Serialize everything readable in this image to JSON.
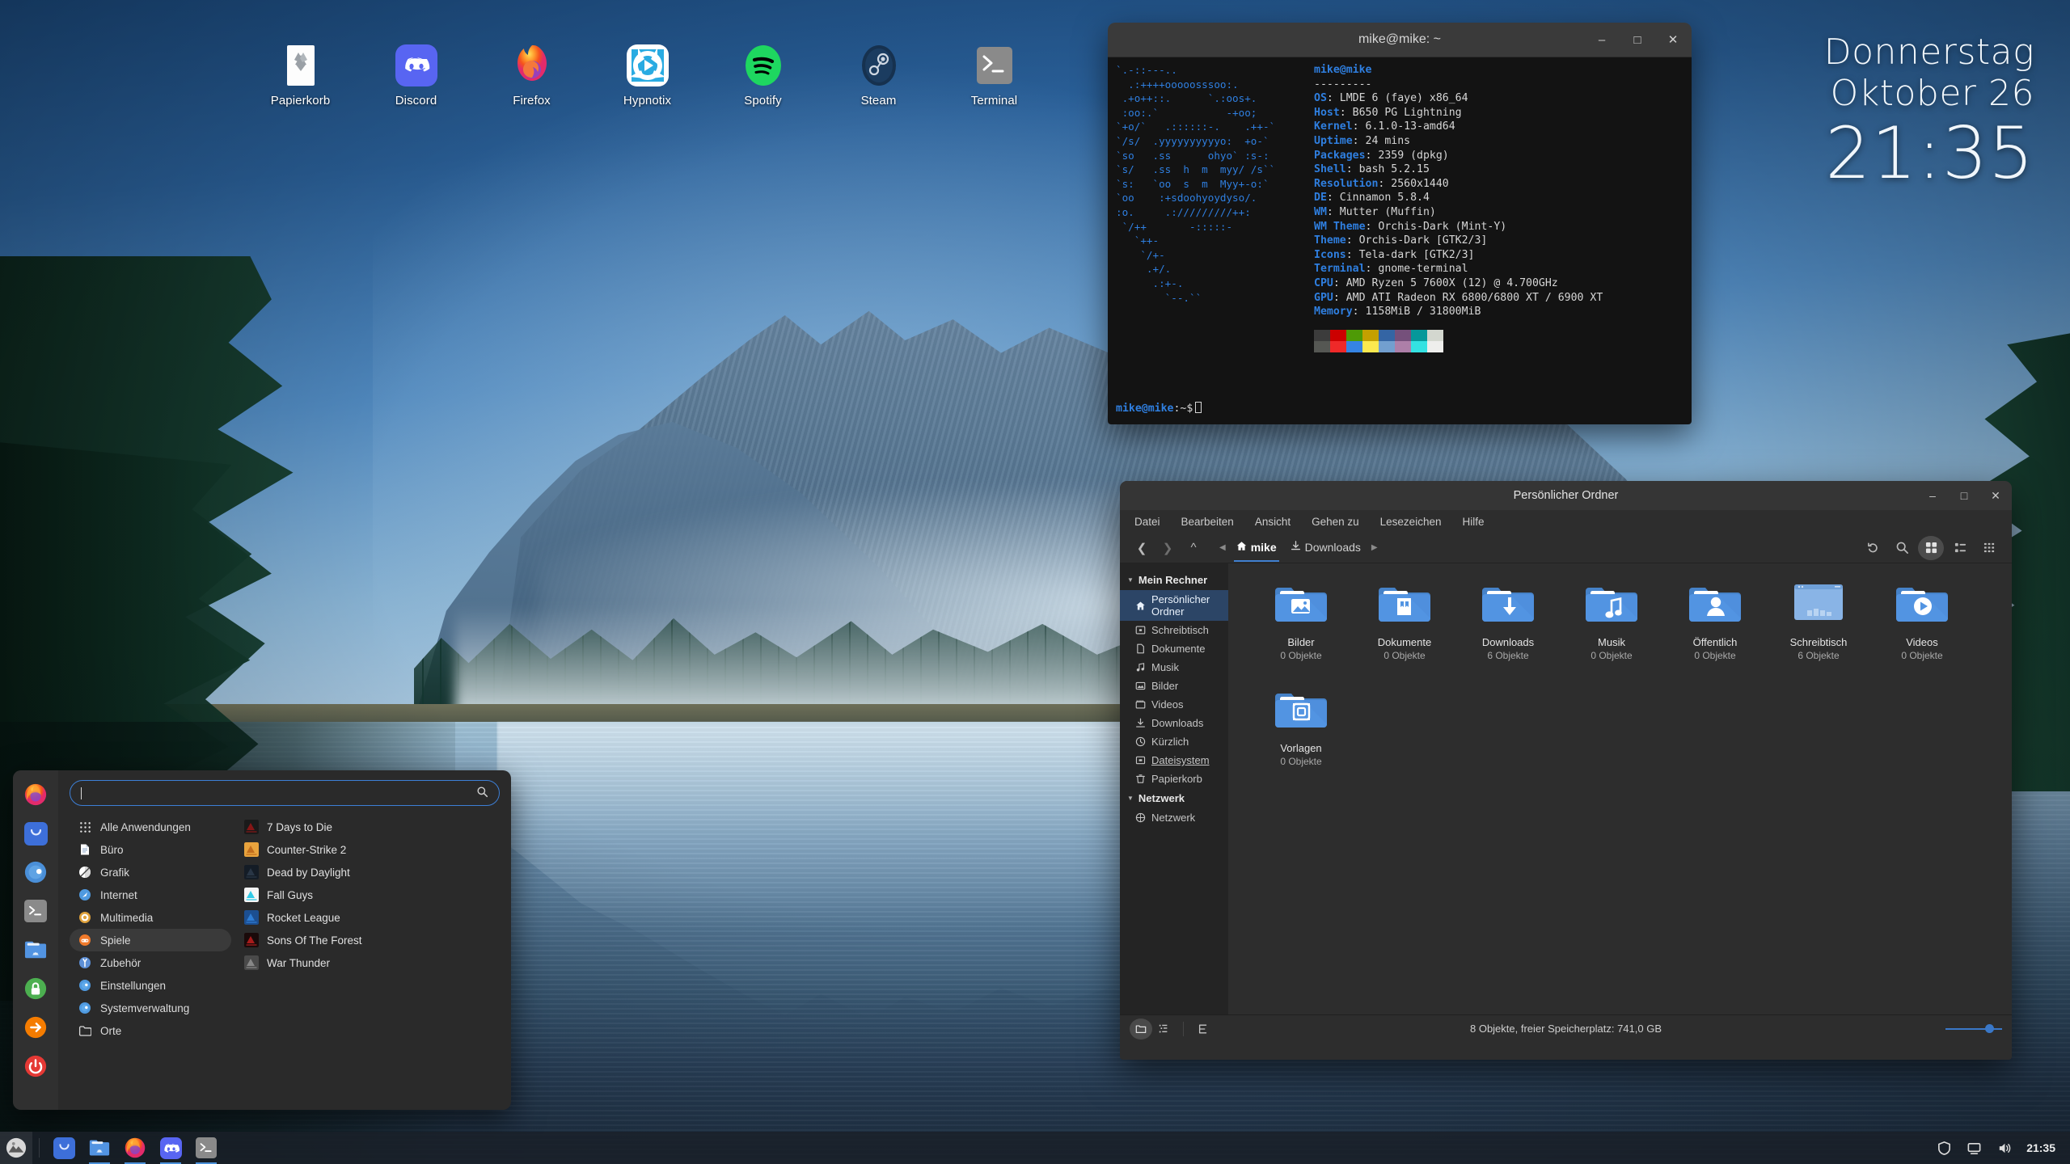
{
  "desktop": {
    "icons": [
      {
        "label": "Papierkorb",
        "icon": "trash-icon"
      },
      {
        "label": "Discord",
        "icon": "discord-icon"
      },
      {
        "label": "Firefox",
        "icon": "firefox-icon"
      },
      {
        "label": "Hypnotix",
        "icon": "hypnotix-icon"
      },
      {
        "label": "Spotify",
        "icon": "spotify-icon"
      },
      {
        "label": "Steam",
        "icon": "steam-icon"
      },
      {
        "label": "Terminal",
        "icon": "terminal-icon"
      }
    ]
  },
  "clock_widget": {
    "weekday": "Donnerstag",
    "date": "Oktober 26",
    "time": "21:35"
  },
  "terminal": {
    "title": "mike@mike: ~",
    "window_buttons": {
      "minimize": "–",
      "maximize": "□",
      "close": "✕"
    },
    "ascii_art": "`.-::---..\n  .:++++ooooosssoo:.\n .+o++::.      `.:oos+.\n :oo:.`           -+oo;\n`+o/`   .::::::-.    .++-`\n`/s/  .yyyyyyyyyyo:  +o-`\n`so   .ss      ohyo` :s-:\n`s/   .ss  h  m  myy/ /s``\n`s:   `oo  s  m  Myy+-o:`\n`oo    :+sdoohyoydyso/.\n:o.     .://///////++:\n `/++       -:::::-\n   `++-\n    `/+-\n     .+/.\n      .:+-.\n        `--.``",
    "user_line": "mike@mike",
    "divider": "---------",
    "info": [
      {
        "key": "OS",
        "value": "LMDE 6 (faye) x86_64"
      },
      {
        "key": "Host",
        "value": "B650 PG Lightning"
      },
      {
        "key": "Kernel",
        "value": "6.1.0-13-amd64"
      },
      {
        "key": "Uptime",
        "value": "24 mins"
      },
      {
        "key": "Packages",
        "value": "2359 (dpkg)"
      },
      {
        "key": "Shell",
        "value": "bash 5.2.15"
      },
      {
        "key": "Resolution",
        "value": "2560x1440"
      },
      {
        "key": "DE",
        "value": "Cinnamon 5.8.4"
      },
      {
        "key": "WM",
        "value": "Mutter (Muffin)"
      },
      {
        "key": "WM Theme",
        "value": "Orchis-Dark (Mint-Y)"
      },
      {
        "key": "Theme",
        "value": "Orchis-Dark [GTK2/3]"
      },
      {
        "key": "Icons",
        "value": "Tela-dark [GTK2/3]"
      },
      {
        "key": "Terminal",
        "value": "gnome-terminal"
      },
      {
        "key": "CPU",
        "value": "AMD Ryzen 5 7600X (12) @ 4.700GHz"
      },
      {
        "key": "GPU",
        "value": "AMD ATI Radeon RX 6800/6800 XT / 6900 XT"
      },
      {
        "key": "Memory",
        "value": "1158MiB / 31800MiB"
      }
    ],
    "swatches_row1": [
      "#3c3c3c",
      "#cc0000",
      "#4e9a06",
      "#c4a000",
      "#3465a4",
      "#75507b",
      "#06989a",
      "#d3d7cf"
    ],
    "swatches_row2": [
      "#555753",
      "#ef2929",
      "#3584e4",
      "#fce94f",
      "#729fcf",
      "#ad7fa8",
      "#34e2e2",
      "#eeeeec"
    ],
    "prompt_user": "mike@mike",
    "prompt_path": ":~$"
  },
  "filemanager": {
    "title": "Persönlicher Ordner",
    "window_buttons": {
      "minimize": "–",
      "maximize": "□",
      "close": "✕"
    },
    "menus": [
      "Datei",
      "Bearbeiten",
      "Ansicht",
      "Gehen zu",
      "Lesezeichen",
      "Hilfe"
    ],
    "breadcrumbs": [
      {
        "label": "mike",
        "icon": "home-icon",
        "active": true
      },
      {
        "label": "Downloads",
        "icon": "download-icon",
        "active": false
      }
    ],
    "sidebar": [
      {
        "label": "Mein Rechner",
        "type": "header"
      },
      {
        "label": "Persönlicher Ordner",
        "icon": "home-icon",
        "active": true
      },
      {
        "label": "Schreibtisch",
        "icon": "desktop-icon"
      },
      {
        "label": "Dokumente",
        "icon": "document-icon"
      },
      {
        "label": "Musik",
        "icon": "music-icon"
      },
      {
        "label": "Bilder",
        "icon": "picture-icon"
      },
      {
        "label": "Videos",
        "icon": "video-icon"
      },
      {
        "label": "Downloads",
        "icon": "download-icon"
      },
      {
        "label": "Kürzlich",
        "icon": "clock-icon"
      },
      {
        "label": "Dateisystem",
        "icon": "drive-icon",
        "underline": true
      },
      {
        "label": "Papierkorb",
        "icon": "trash-icon"
      },
      {
        "label": "Netzwerk",
        "type": "header"
      },
      {
        "label": "Netzwerk",
        "icon": "network-icon"
      }
    ],
    "files": [
      {
        "name": "Bilder",
        "count": "0 Objekte",
        "icon": "folder-pictures"
      },
      {
        "name": "Dokumente",
        "count": "0 Objekte",
        "icon": "folder-documents"
      },
      {
        "name": "Downloads",
        "count": "6 Objekte",
        "icon": "folder-downloads"
      },
      {
        "name": "Musik",
        "count": "0 Objekte",
        "icon": "folder-music"
      },
      {
        "name": "Öffentlich",
        "count": "0 Objekte",
        "icon": "folder-public"
      },
      {
        "name": "Schreibtisch",
        "count": "6 Objekte",
        "icon": "folder-desktop"
      },
      {
        "name": "Videos",
        "count": "0 Objekte",
        "icon": "folder-videos"
      },
      {
        "name": "Vorlagen",
        "count": "0 Objekte",
        "icon": "folder-templates"
      }
    ],
    "status": "8 Objekte, freier Speicherplatz: 741,0 GB",
    "toolbar_icons": [
      "back-icon",
      "forward-icon",
      "up-icon",
      "reload-icon",
      "search-icon",
      "icon-view-icon",
      "compact-view-icon",
      "list-view-icon"
    ]
  },
  "appmenu": {
    "search_placeholder": "",
    "search_value": "",
    "favorites": [
      {
        "name": "firefox-fav-icon"
      },
      {
        "name": "software-manager-fav-icon"
      },
      {
        "name": "system-settings-fav-icon"
      },
      {
        "name": "terminal-fav-icon"
      },
      {
        "name": "files-fav-icon"
      },
      {
        "name": "lock-screen-fav-icon"
      },
      {
        "name": "logout-fav-icon"
      },
      {
        "name": "shutdown-fav-icon"
      }
    ],
    "categories": [
      {
        "label": "Alle Anwendungen",
        "icon": "grid-icon",
        "active": false
      },
      {
        "label": "Büro",
        "icon": "office-icon",
        "active": false
      },
      {
        "label": "Grafik",
        "icon": "graphics-icon",
        "active": false
      },
      {
        "label": "Internet",
        "icon": "internet-icon",
        "active": false
      },
      {
        "label": "Multimedia",
        "icon": "multimedia-icon",
        "active": false
      },
      {
        "label": "Spiele",
        "icon": "games-icon",
        "active": true
      },
      {
        "label": "Zubehör",
        "icon": "accessories-icon",
        "active": false
      },
      {
        "label": "Einstellungen",
        "icon": "preferences-icon",
        "active": false
      },
      {
        "label": "Systemverwaltung",
        "icon": "administration-icon",
        "active": false
      },
      {
        "label": "Orte",
        "icon": "places-icon",
        "active": false
      }
    ],
    "apps": [
      {
        "label": "7 Days to Die",
        "icon": "game-7dtd-icon",
        "color1": "#1a1a1a",
        "color2": "#8b1616"
      },
      {
        "label": "Counter-Strike 2",
        "icon": "game-cs2-icon",
        "color1": "#e8a33d",
        "color2": "#c06a1b"
      },
      {
        "label": "Dead by Daylight",
        "icon": "game-dbd-icon",
        "color1": "#141c26",
        "color2": "#2a3848"
      },
      {
        "label": "Fall Guys",
        "icon": "game-fallguys-icon",
        "color1": "#f5f5f5",
        "color2": "#25c7e6"
      },
      {
        "label": "Rocket League",
        "icon": "game-rocketleague-icon",
        "color1": "#1c4f91",
        "color2": "#2f7fd8"
      },
      {
        "label": "Sons Of The Forest",
        "icon": "game-sotf-icon",
        "color1": "#1a0a0a",
        "color2": "#b01c1c"
      },
      {
        "label": "War Thunder",
        "icon": "game-warthunder-icon",
        "color1": "#4a4a4a",
        "color2": "#8a8a8a"
      }
    ]
  },
  "panel": {
    "menu_button": "mint-menu-icon",
    "launchers": [
      {
        "name": "software-manager-launcher"
      },
      {
        "name": "files-launcher",
        "open": true
      },
      {
        "name": "firefox-launcher",
        "open": true
      },
      {
        "name": "discord-launcher",
        "open": true
      },
      {
        "name": "terminal-launcher",
        "open": true
      }
    ],
    "tray": [
      {
        "name": "shield-icon"
      },
      {
        "name": "display-icon"
      },
      {
        "name": "volume-icon"
      }
    ],
    "clock": "21:35"
  },
  "colors": {
    "accent": "#3f7fd0",
    "panel_bg": "#1a2028",
    "window_bg": "#2d2d2d",
    "sidebar_bg": "#242424",
    "terminal_bg": "#131313",
    "terminal_blue": "#2f7fe0",
    "folder_blue": "#5294e2"
  }
}
